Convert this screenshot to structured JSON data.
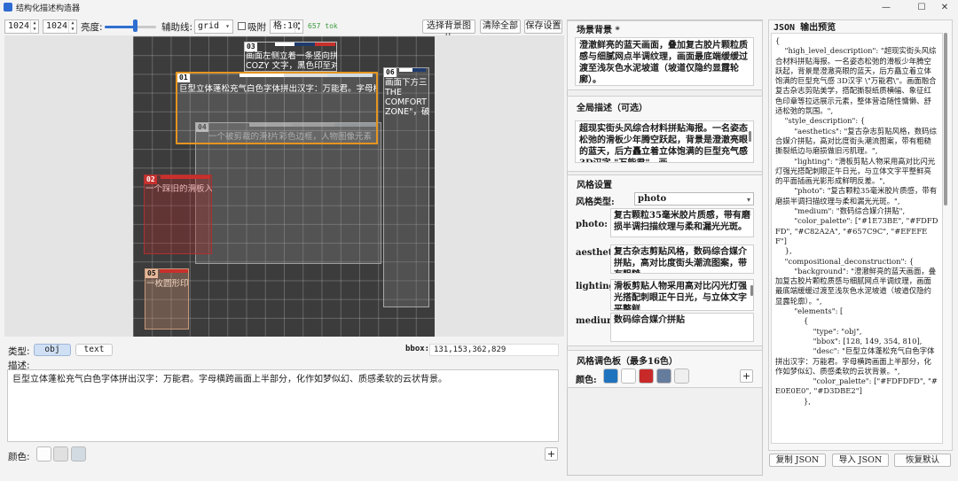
{
  "window": {
    "title": "结构化描述构造器",
    "minimize": "—",
    "maximize": "☐",
    "close": "✕"
  },
  "toolbar": {
    "width": "1024",
    "height": "1024",
    "brightness_label": "亮度:",
    "brightness_value": 0.6,
    "guides_label": "辅助线:",
    "guides_value": "grid",
    "snap_label": "吸附",
    "grid_value": "格:10",
    "tokens": "657 tok",
    "select_bg": "选择背景图片",
    "clear_all": "清除全部",
    "save_settings": "保存设置"
  },
  "elements": [
    {
      "id": "01",
      "text": "巨型立体蓬松充气白色字体拼出汉字：万能君。字母横",
      "palette": [
        "#FDFDFD",
        "#E0E0E0",
        "#D3DBE2"
      ],
      "selected": true
    },
    {
      "id": "02",
      "text": "一个踩旧的滑板入",
      "palette": [
        "#C8302C",
        "#C8302C"
      ]
    },
    {
      "id": "03",
      "text": "画面左侧立着一条竖向拼",
      "text2": "COZY 文字，黑色印至对",
      "palette": [
        "#FDFDFD",
        "#1E3B6E",
        "#C8302C"
      ]
    },
    {
      "id": "04",
      "text": "一个被剪裁的滑板人物图",
      "text2": "片彩色边框，人物图像元素",
      "palette": [
        "#FDFDFD",
        "#EFEFEF",
        "#D3DBE2"
      ]
    },
    {
      "id": "05",
      "text": "一枚圆形印",
      "palette": [
        "#C8302C",
        "#C8302C"
      ]
    },
    {
      "id": "06",
      "text": "画面下方三",
      "text2": "THE",
      "text3": "COMFORT",
      "text4": "ZONE\"，破损",
      "palette": [
        "#FDFDFD",
        "#1E3B6E"
      ]
    }
  ],
  "editor": {
    "type_label": "类型:",
    "type_obj": "obj",
    "type_text": "text",
    "bbox_label": "bbox:",
    "bbox_value": "131,153,362,829",
    "desc_label": "描述:",
    "desc_value": "巨型立体蓬松充气白色字体拼出汉字：万能君。字母横跨画面上半部分，化作如梦似幻、质感柔软的云状背景。",
    "color_label": "颜色:",
    "colors": [
      "#FDFDFD",
      "#E0E0E0",
      "#D3DBE2"
    ],
    "add": "+"
  },
  "scene": {
    "bg_title": "场景背景 *",
    "bg_value": "澄澈鲜亮的蓝天画面，叠加复古胶片颗粒质感与细腻网点半调纹理，画面最底端缓缓过渡至浅灰色水泥坡道（坡道仅隐约显露轮廓）。",
    "global_title": "全局描述（可选）",
    "global_value": "超现实街头风综合材料拼贴海报。一名姿态松弛的滑板少年腾空跃起，背景是澄澈亮眼的蓝天，后方矗立着立体饱满的巨型充气感 3D汉字 \"万能君\"。画",
    "style_title": "风格设置",
    "style_type_label": "风格类型:",
    "style_type_value": "photo",
    "photo_label": "photo:",
    "photo_value": "复古颗粒35毫米胶片质感，带有磨损半调扫描纹理与柔和漏光光斑。",
    "aesthetics_label": "aesthetics:",
    "aesthetics_value": "复古杂志剪贴风格，数码综合媒介拼贴，高对比度街头潮流图案，带有粗糙",
    "lighting_label": "lighting:",
    "lighting_value": "滑板剪贴人物采用高对比闪光灯强光搭配刺眼正午日光，与立体文字平整鲜",
    "medium_label": "medium:",
    "medium_value": "数码综合媒介拼贴",
    "palette_title": "风格调色板（最多16色）",
    "palette_label": "颜色:",
    "palette_colors": [
      "#1E73BE",
      "#FDFDFD",
      "#C82A2A",
      "#657C9C",
      "#EFEFEF"
    ],
    "add": "+"
  },
  "json_panel": {
    "title": "JSON 输出预览",
    "content": "{\n    \"high_level_description\": \"超现实街头风综合材料拼贴海报。一名姿态松弛的滑板少年腾空跃起，背景是澄澈亮眼的蓝天，后方矗立着立体饱满的巨型充气感 3D汉字 \\\"万能君\\\"。画面融合复古杂志剪贴美学，搭配撕裂纸质横幅、象征红色印章等拉远展示元素，整体营造随性慵懒、舒适松弛的氛围。\",\n    \"style_description\": {\n        \"aesthetics\": \"复古杂志剪贴风格，数码综合媒介拼贴，高对比度街头潮流图案，带有粗糙撕裂纸边与磨损做旧污肌理。\",\n        \"lighting\": \"滑板剪贴人物采用高对比闪光灯强光搭配刺眼正午日光，与立体文字平整鲜亮的平面插画光影形成鲜明反差。\",\n        \"photo\": \"复古颗粒35毫米胶片质感，带有磨损半调扫描纹理与柔和漏光光斑。\",\n        \"medium\": \"数码综合媒介拼贴\",\n        \"color_palette\": [\"#1E73BE\", \"#FDFDFD\", \"#C82A2A\", \"#657C9C\", \"#EFEFEF\"]\n    },\n    \"compositional_deconstruction\": {\n        \"background\": \"澄澈鲜亮的蓝天画面，叠加复古胶片颗粒质感与细腻网点半调纹理，画面最底端缓缓过渡至浅灰色水泥坡道（坡道仅隐约显露轮廓）。\",\n        \"elements\": [\n            {\n                \"type\": \"obj\",\n                \"bbox\": [128, 149, 354, 810],\n                \"desc\": \"巨型立体蓬松充气白色字体拼出汉字：万能君。字母横跨画面上半部分，化作如梦似幻、质感柔软的云状背景。\",\n                \"color_palette\": [\"#FDFDFD\", \"#E0E0E0\", \"#D3DBE2\"]\n            },",
    "copy": "复制 JSON",
    "import": "导入 JSON",
    "reset": "恢复默认"
  }
}
